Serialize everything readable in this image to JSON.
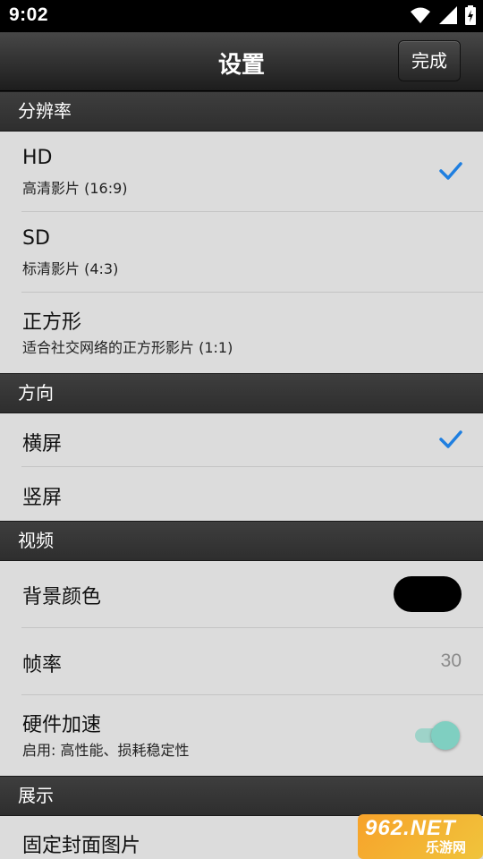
{
  "status_bar": {
    "time": "9:02",
    "icons": [
      "wifi-icon",
      "signal-icon",
      "battery-icon"
    ]
  },
  "navbar": {
    "title": "设置",
    "done_label": "完成"
  },
  "sections": {
    "resolution": {
      "header": "分辨率",
      "items": [
        {
          "title": "HD",
          "subtitle": "高清影片 (16:9)",
          "checked": true
        },
        {
          "title": "SD",
          "subtitle": "标清影片 (4:3)",
          "checked": false
        },
        {
          "title": "正方形",
          "subtitle": "适合社交网络的正方形影片 (1:1)",
          "checked": false
        }
      ]
    },
    "orientation": {
      "header": "方向",
      "items": [
        {
          "title": "横屏",
          "checked": true
        },
        {
          "title": "竖屏",
          "checked": false
        }
      ]
    },
    "video": {
      "header": "视频",
      "background_color": {
        "title": "背景颜色",
        "color": "#000000"
      },
      "frame_rate": {
        "title": "帧率",
        "value": "30"
      },
      "hardware_accel": {
        "title": "硬件加速",
        "subtitle": "启用: 高性能、损耗稳定性",
        "enabled": true
      }
    },
    "display": {
      "header": "展示",
      "items": [
        {
          "title": "固定封面图片"
        }
      ]
    }
  },
  "colors": {
    "accent_check": "#1f7fe0",
    "toggle_on": "#7fcfc1"
  },
  "watermark": {
    "brand": "962.NET",
    "site": "乐游网"
  }
}
